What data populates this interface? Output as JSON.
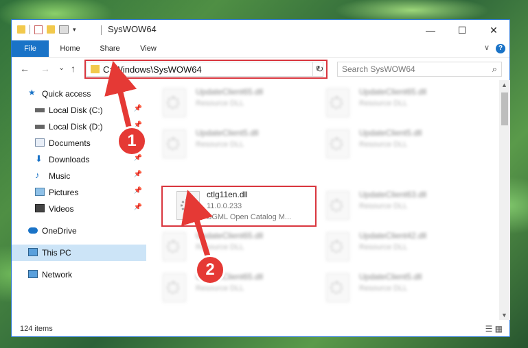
{
  "window": {
    "title": "SysWOW64",
    "minimize": "—",
    "maximize": "☐",
    "close": "✕"
  },
  "ribbon": {
    "tabs": [
      "File",
      "Home",
      "Share",
      "View"
    ],
    "collapse": "∨",
    "help": "?"
  },
  "nav": {
    "back": "←",
    "forward": "→",
    "recent": "⌄",
    "up": "↑"
  },
  "address": {
    "path": "C:\\Windows\\SysWOW64",
    "dropdown": "∨",
    "refresh": "↻"
  },
  "search": {
    "placeholder": "Search SysWOW64",
    "icon": "⌕"
  },
  "sidebar": {
    "items": [
      {
        "label": "Quick access",
        "icon": "star-icon",
        "pinned": false
      },
      {
        "label": "Local Disk (C:)",
        "icon": "drive-icon",
        "pinned": true
      },
      {
        "label": "Local Disk (D:)",
        "icon": "drive-icon",
        "pinned": true
      },
      {
        "label": "Documents",
        "icon": "documents-icon",
        "pinned": true
      },
      {
        "label": "Downloads",
        "icon": "downloads-icon",
        "pinned": true
      },
      {
        "label": "Music",
        "icon": "music-icon",
        "pinned": true
      },
      {
        "label": "Pictures",
        "icon": "pictures-icon",
        "pinned": true
      },
      {
        "label": "Videos",
        "icon": "videos-icon",
        "pinned": true
      },
      {
        "label": "OneDrive",
        "icon": "onedrive-icon",
        "pinned": false
      },
      {
        "label": "This PC",
        "icon": "pc-icon",
        "pinned": false
      },
      {
        "label": "Network",
        "icon": "network-icon",
        "pinned": false
      }
    ],
    "pin_glyph": "📌"
  },
  "files": {
    "blurred": [
      {
        "name": "UpdateClient65.dll",
        "desc": "Resource DLL"
      },
      {
        "name": "UpdateClient65.dll",
        "desc": "Resource DLL"
      },
      {
        "name": "UpdateClient5.dll",
        "desc": "Resource DLL"
      },
      {
        "name": "UpdateClient5.dll",
        "desc": "Resource DLL"
      },
      {
        "name": "UpdateClient63.dll",
        "desc": "Resource DLL"
      },
      {
        "name": "UpdateClient65.dll",
        "desc": "Resource DLL"
      },
      {
        "name": "UpdateClient42.dll",
        "desc": "Resource DLL"
      },
      {
        "name": "UpdateClient65.dll",
        "desc": "Resource DLL"
      },
      {
        "name": "UpdateClient5.dll",
        "desc": "Resource DLL"
      }
    ],
    "highlighted": {
      "name": "ctlg11en.dll",
      "version": "11.0.0.233",
      "desc": "SGML Open Catalog M..."
    }
  },
  "status": {
    "count": "124 items",
    "views": "☰ ▦"
  },
  "callouts": [
    "1",
    "2"
  ],
  "colors": {
    "accent": "#1a73c7",
    "highlight": "#d9363e",
    "selected": "#cce4f7"
  }
}
